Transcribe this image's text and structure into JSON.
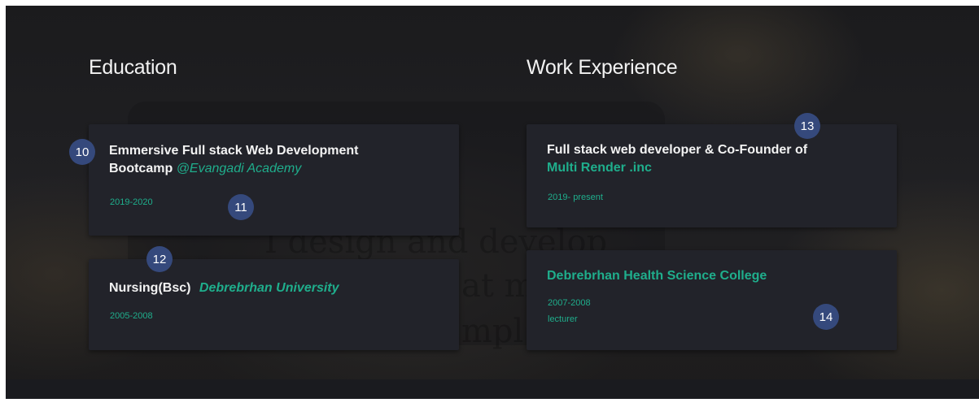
{
  "education": {
    "heading": "Education",
    "items": [
      {
        "title_line1": "Emmersive Full stack Web Development",
        "title_line2": "Bootcamp",
        "institution": "@Evangadi Academy",
        "years": "2019-2020"
      },
      {
        "title": "Nursing(Bsc)",
        "institution": "Debrebrhan University",
        "years": "2005-2008"
      }
    ]
  },
  "work": {
    "heading": "Work Experience",
    "items": [
      {
        "title_line1": "Full stack web developer & Co-Founder of",
        "company": "Multi Render .inc",
        "years": "2019- present"
      },
      {
        "company": "Debrebrhan Health Science College",
        "years": "2007-2008",
        "role": "lecturer"
      }
    ]
  },
  "background_text": {
    "line1": "I design and develop",
    "line2": "at m",
    "line3": "mpl"
  },
  "annotations": [
    "10",
    "11",
    "12",
    "13",
    "14"
  ],
  "colors": {
    "accent": "#1fae8c",
    "card": "#22232a",
    "badge": "#35497c",
    "heading": "#f2f2f2"
  }
}
